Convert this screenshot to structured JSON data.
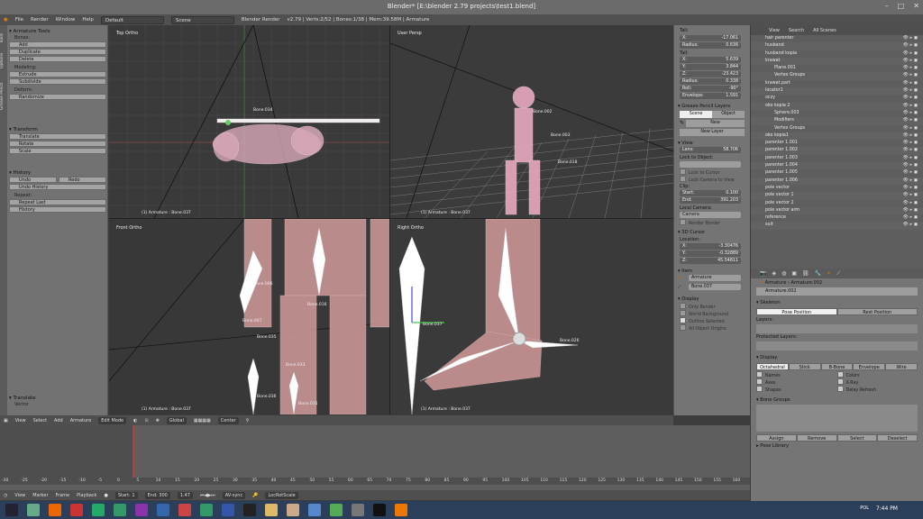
{
  "window": {
    "title": "Blender* [E:\\blender 2.79 projects\\test1.blend]",
    "controls": [
      "–",
      "□",
      "✕"
    ]
  },
  "menubar": {
    "items": [
      "File",
      "Render",
      "Window",
      "Help"
    ],
    "screen_layout": "Default",
    "scene": "Scene",
    "engine": "Blender Render",
    "stats": "v2.79 | Verts:2/52 | Bones:1/38 | Mem:39.58M | Armature"
  },
  "toolshelf": {
    "vtabs": [
      "Tools",
      "Options",
      "Grease Pencil"
    ],
    "armature_tools": {
      "header": "Armature Tools",
      "bones_label": "Bones:",
      "bones_buttons": [
        "Add",
        "Duplicate",
        "Delete"
      ],
      "modeling_label": "Modeling:",
      "modeling_buttons": [
        "Extrude",
        "Subdivide"
      ],
      "deform_label": "Deform:",
      "deform_buttons": [
        "Randomize"
      ]
    },
    "transform": {
      "header": "Transform",
      "buttons": [
        "Translate",
        "Rotate",
        "Scale"
      ]
    },
    "history": {
      "header": "History",
      "undo": "Undo",
      "redo": "Redo",
      "undo_history": "Undo History",
      "repeat_label": "Repeat:",
      "repeat_last": "Repeat Last",
      "hist": "History"
    },
    "operator": {
      "header": "Translate",
      "vector": "Vector"
    }
  },
  "viewports": {
    "top_left": {
      "label": "Top Ortho",
      "footer": "(1) Armature : Bone.037"
    },
    "top_right": {
      "label": "User Persp",
      "footer": "(1) Armature : Bone.037"
    },
    "bottom_left": {
      "label": "Front Ortho",
      "footer": "(1) Armature : Bone.037"
    },
    "bottom_right": {
      "label": "Right Ortho",
      "footer": "(1) Armature : Bone.037"
    },
    "bone_labels": [
      "Bone.006",
      "Bone.007",
      "Bone.035",
      "Bone.033",
      "Bone.036",
      "Bone.035",
      "Bone.037",
      "Bone.016",
      "Bone.002",
      "Bone.003",
      "Bone.018",
      "Bone.026",
      "Bone.034"
    ]
  },
  "v3d_header": {
    "items": [
      "View",
      "Select",
      "Add",
      "Armature"
    ],
    "mode": "Edit Mode",
    "orientation": "Global",
    "pivot": "Center"
  },
  "npanel": {
    "tail_label": "Tail:",
    "tail_values": [
      {
        "k": "X:",
        "v": "-17.061"
      },
      {
        "k": "Radius:",
        "v": "0.636"
      }
    ],
    "tail2_label": "Tail:",
    "tail2_values": [
      {
        "k": "X:",
        "v": "5.639"
      },
      {
        "k": "Y:",
        "v": "3.844"
      },
      {
        "k": "Z:",
        "v": "-23.423"
      },
      {
        "k": "Radius:",
        "v": "0.338"
      },
      {
        "k": "Roll:",
        "v": "-90°"
      },
      {
        "k": "Envelope:",
        "v": "1.591"
      }
    ],
    "grease_pencil": {
      "header": "Grease Pencil Layers",
      "tabs": [
        "Scene",
        "Object"
      ],
      "new": "New",
      "new_layer": "New Layer"
    },
    "view": {
      "header": "View",
      "lens": {
        "k": "Lens:",
        "v": "58.706"
      },
      "lock_to_object": "Lock to Object:",
      "lock_to_cursor": "Lock to Cursor",
      "lock_camera": "Lock Camera to View",
      "clip_label": "Clip:",
      "clip_start": {
        "k": "Start:",
        "v": "0.100"
      },
      "clip_end": {
        "k": "End:",
        "v": "391.203"
      },
      "local_camera": "Local Camera:",
      "camera": "Camera",
      "render_border": "Render Border"
    },
    "cursor": {
      "header": "3D Cursor",
      "location": "Location:",
      "x": {
        "k": "X:",
        "v": "-3.30476"
      },
      "y": {
        "k": "Y:",
        "v": "-0.32889"
      },
      "z": {
        "k": "Z:",
        "v": "45.54811"
      }
    },
    "item": {
      "header": "Item",
      "name1": "Armature",
      "name2": "Bone.037"
    },
    "display": {
      "header": "Display",
      "only_render": "Only Render",
      "world_background": "World Background",
      "outline_selected": "Outline Selected",
      "all_object_origins": "All Object Origins"
    }
  },
  "outliner": {
    "header": [
      "View",
      "Search",
      "All Scenes"
    ],
    "rows": [
      "hair parenter",
      "husband",
      "husband kopia",
      "krawat",
      "Plane.001",
      "Vertex Groups",
      "krawat.part",
      "locator1",
      "oczy",
      "oko kopia 2",
      "Sphere.003",
      "Modifiers",
      "Vertex Groups",
      "oko kopia1",
      "parenter 1.001",
      "parenter 1.002",
      "parenter 1.003",
      "parenter 1.004",
      "parenter 1.005",
      "parenter 1.006",
      "pole vector",
      "pole vector 1",
      "pole vector 2",
      "pole vector arm",
      "reference",
      "suit"
    ]
  },
  "properties": {
    "crumb1": "Armature",
    "crumb2": "Armature.002",
    "name_field": "Armature.002",
    "skeleton": {
      "header": "Skeleton",
      "pose_position": "Pose Position",
      "rest_position": "Rest Position",
      "layers": "Layers:",
      "protected_layers": "Protected Layers:"
    },
    "display": {
      "header": "Display",
      "modes": [
        "Octahedral",
        "Stick",
        "B-Bone",
        "Envelope",
        "Wire"
      ],
      "names": "Names",
      "colors": "Colors",
      "axes": "Axes",
      "xray": "X-Ray",
      "shapes": "Shapes",
      "delay_refresh": "Delay Refresh"
    },
    "bone_groups": {
      "header": "Bone Groups",
      "buttons": [
        "Assign",
        "Remove",
        "Select",
        "Deselect"
      ]
    },
    "pose_library": "Pose Library"
  },
  "timeline": {
    "ticks": [
      "-30",
      "-25",
      "-20",
      "-15",
      "-10",
      "-5",
      "0",
      "5",
      "10",
      "15",
      "20",
      "25",
      "30",
      "35",
      "40",
      "45",
      "50",
      "55",
      "60",
      "65",
      "70",
      "75",
      "80",
      "85",
      "90",
      "95",
      "100",
      "105",
      "110",
      "115",
      "120",
      "125",
      "130",
      "135",
      "140",
      "145",
      "150",
      "155",
      "160"
    ],
    "header": [
      "View",
      "Marker",
      "Frame",
      "Playback"
    ],
    "start": "Start:",
    "start_val": "1",
    "end": "End:",
    "end_val": "300",
    "current": "1.47",
    "sync": "AV-sync",
    "keying": "LocRotScale"
  },
  "taskbar": {
    "lang": "POL",
    "clock": "7:44 PM"
  }
}
